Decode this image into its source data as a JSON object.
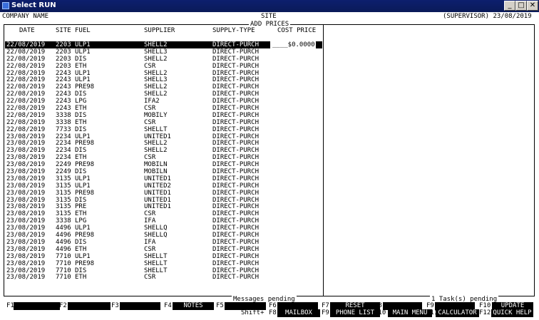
{
  "window": {
    "title": "Select RUN"
  },
  "header": {
    "company": "COMPANY NAME",
    "site": "SITE",
    "user_date": "(SUPERVISOR) 23/08/2019",
    "section_title": "ADD PRICES"
  },
  "table": {
    "columns": {
      "date": "DATE",
      "site": "SITE",
      "fuel": "FUEL",
      "supplier": "SUPPLIER",
      "supply_type": "SUPPLY-TYPE",
      "cost_price": "COST PRICE"
    },
    "selected_cost_value": "____$0.0000",
    "rows": [
      [
        "22/08/2019",
        "2203",
        "ULP1",
        "SHELL2",
        "DIRECT-PURCH"
      ],
      [
        "22/08/2019",
        "2203",
        "ULP1",
        "SHELL3",
        "DIRECT-PURCH"
      ],
      [
        "22/08/2019",
        "2203",
        "DIS",
        "SHELL2",
        "DIRECT-PURCH"
      ],
      [
        "22/08/2019",
        "2203",
        "ETH",
        "CSR",
        "DIRECT-PURCH"
      ],
      [
        "22/08/2019",
        "2243",
        "ULP1",
        "SHELL2",
        "DIRECT-PURCH"
      ],
      [
        "22/08/2019",
        "2243",
        "ULP1",
        "SHELL3",
        "DIRECT-PURCH"
      ],
      [
        "22/08/2019",
        "2243",
        "PRE98",
        "SHELL2",
        "DIRECT-PURCH"
      ],
      [
        "22/08/2019",
        "2243",
        "DIS",
        "SHELL2",
        "DIRECT-PURCH"
      ],
      [
        "22/08/2019",
        "2243",
        "LPG",
        "IFA2",
        "DIRECT-PURCH"
      ],
      [
        "22/08/2019",
        "2243",
        "ETH",
        "CSR",
        "DIRECT-PURCH"
      ],
      [
        "22/08/2019",
        "3338",
        "DIS",
        "MOBILY",
        "DIRECT-PURCH"
      ],
      [
        "22/08/2019",
        "3338",
        "ETH",
        "CSR",
        "DIRECT-PURCH"
      ],
      [
        "22/08/2019",
        "7733",
        "DIS",
        "SHELLT",
        "DIRECT-PURCH"
      ],
      [
        "23/08/2019",
        "2234",
        "ULP1",
        "UNITED1",
        "DIRECT-PURCH"
      ],
      [
        "23/08/2019",
        "2234",
        "PRE98",
        "SHELL2",
        "DIRECT-PURCH"
      ],
      [
        "23/08/2019",
        "2234",
        "DIS",
        "SHELL2",
        "DIRECT-PURCH"
      ],
      [
        "23/08/2019",
        "2234",
        "ETH",
        "CSR",
        "DIRECT-PURCH"
      ],
      [
        "23/08/2019",
        "2249",
        "PRE98",
        "MOBILN",
        "DIRECT-PURCH"
      ],
      [
        "23/08/2019",
        "2249",
        "DIS",
        "MOBILN",
        "DIRECT-PURCH"
      ],
      [
        "23/08/2019",
        "3135",
        "ULP1",
        "UNITED1",
        "DIRECT-PURCH"
      ],
      [
        "23/08/2019",
        "3135",
        "ULP1",
        "UNITED2",
        "DIRECT-PURCH"
      ],
      [
        "23/08/2019",
        "3135",
        "PRE98",
        "UNITED1",
        "DIRECT-PURCH"
      ],
      [
        "23/08/2019",
        "3135",
        "DIS",
        "UNITED1",
        "DIRECT-PURCH"
      ],
      [
        "23/08/2019",
        "3135",
        "PRE",
        "UNITED1",
        "DIRECT-PURCH"
      ],
      [
        "23/08/2019",
        "3135",
        "ETH",
        "CSR",
        "DIRECT-PURCH"
      ],
      [
        "23/08/2019",
        "3338",
        "LPG",
        "IFA",
        "DIRECT-PURCH"
      ],
      [
        "23/08/2019",
        "4496",
        "ULP1",
        "SHELLQ",
        "DIRECT-PURCH"
      ],
      [
        "23/08/2019",
        "4496",
        "PRE98",
        "SHELLQ",
        "DIRECT-PURCH"
      ],
      [
        "23/08/2019",
        "4496",
        "DIS",
        "IFA",
        "DIRECT-PURCH"
      ],
      [
        "23/08/2019",
        "4496",
        "ETH",
        "CSR",
        "DIRECT-PURCH"
      ],
      [
        "23/08/2019",
        "7710",
        "ULP1",
        "SHELLT",
        "DIRECT-PURCH"
      ],
      [
        "23/08/2019",
        "7710",
        "PRE98",
        "SHELLT",
        "DIRECT-PURCH"
      ],
      [
        "23/08/2019",
        "7710",
        "DIS",
        "SHELLT",
        "DIRECT-PURCH"
      ],
      [
        "23/08/2019",
        "7710",
        "ETH",
        "CSR",
        "DIRECT-PURCH"
      ]
    ]
  },
  "footer": {
    "messages": "Messages pending",
    "tasks": "1 Task(s) pending",
    "shift_label": "Shift+",
    "fkeys_row1": [
      {
        "key": "F1",
        "label": ""
      },
      {
        "key": "F2",
        "label": ""
      },
      {
        "key": "F3",
        "label": ""
      },
      {
        "key": "F4",
        "label": "NOTES"
      },
      {
        "key": "F5",
        "label": ""
      },
      {
        "key": "F6",
        "label": ""
      },
      {
        "key": "F7",
        "label": "RESET"
      },
      {
        "key": "F8",
        "label": ""
      },
      {
        "key": "F9",
        "label": ""
      },
      {
        "key": "F10",
        "label": "UPDATE"
      }
    ],
    "fkeys_row2": [
      {
        "key": "F8",
        "label": "MAILBOX"
      },
      {
        "key": "F9",
        "label": "PHONE LIST"
      },
      {
        "key": "F10",
        "label": "MAIN MENU"
      },
      {
        "key": "F11",
        "label": "CALCULATOR"
      },
      {
        "key": "F12",
        "label": "QUICK HELP"
      }
    ]
  }
}
